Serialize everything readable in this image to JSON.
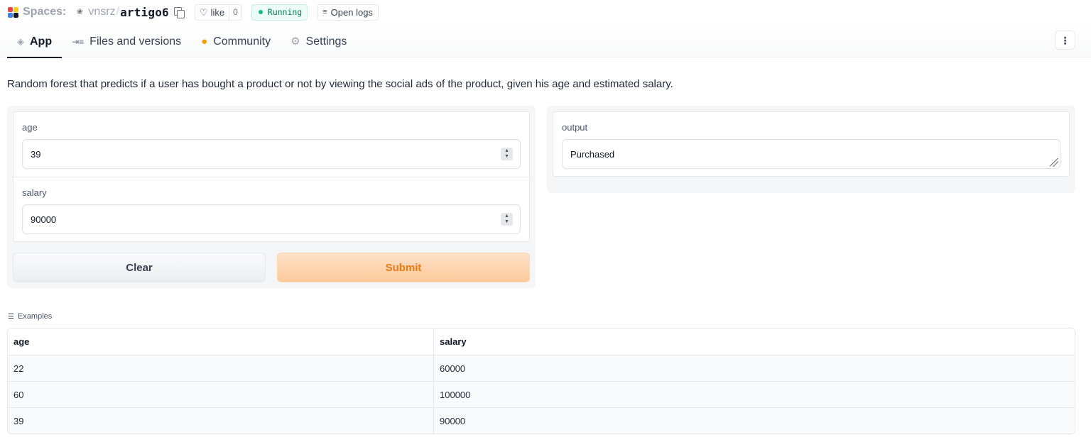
{
  "header": {
    "spaces_label": "Spaces:",
    "owner": "vnsrz",
    "separator": "/",
    "repo": "artigo6",
    "like_label": "like",
    "like_count": "0",
    "status": "Running",
    "logs_label": "Open logs",
    "status_color": "#10b981"
  },
  "tabs": [
    {
      "label": "App",
      "icon": "app-cube-icon"
    },
    {
      "label": "Files and versions",
      "icon": "files-icon"
    },
    {
      "label": "Community",
      "icon": "community-icon"
    },
    {
      "label": "Settings",
      "icon": "gear-icon"
    }
  ],
  "description": "Random forest that predicts if a user has bought a product or not by viewing the social ads of the product, given his age and estimated salary.",
  "inputs": {
    "age": {
      "label": "age",
      "value": "39"
    },
    "salary": {
      "label": "salary",
      "value": "90000"
    }
  },
  "buttons": {
    "clear": "Clear",
    "submit": "Submit",
    "submit_color": "#ea7a12"
  },
  "output": {
    "label": "output",
    "value": "Purchased"
  },
  "examples": {
    "title": "Examples",
    "headers": [
      "age",
      "salary"
    ],
    "rows": [
      [
        "22",
        "60000"
      ],
      [
        "60",
        "100000"
      ],
      [
        "39",
        "90000"
      ]
    ]
  }
}
